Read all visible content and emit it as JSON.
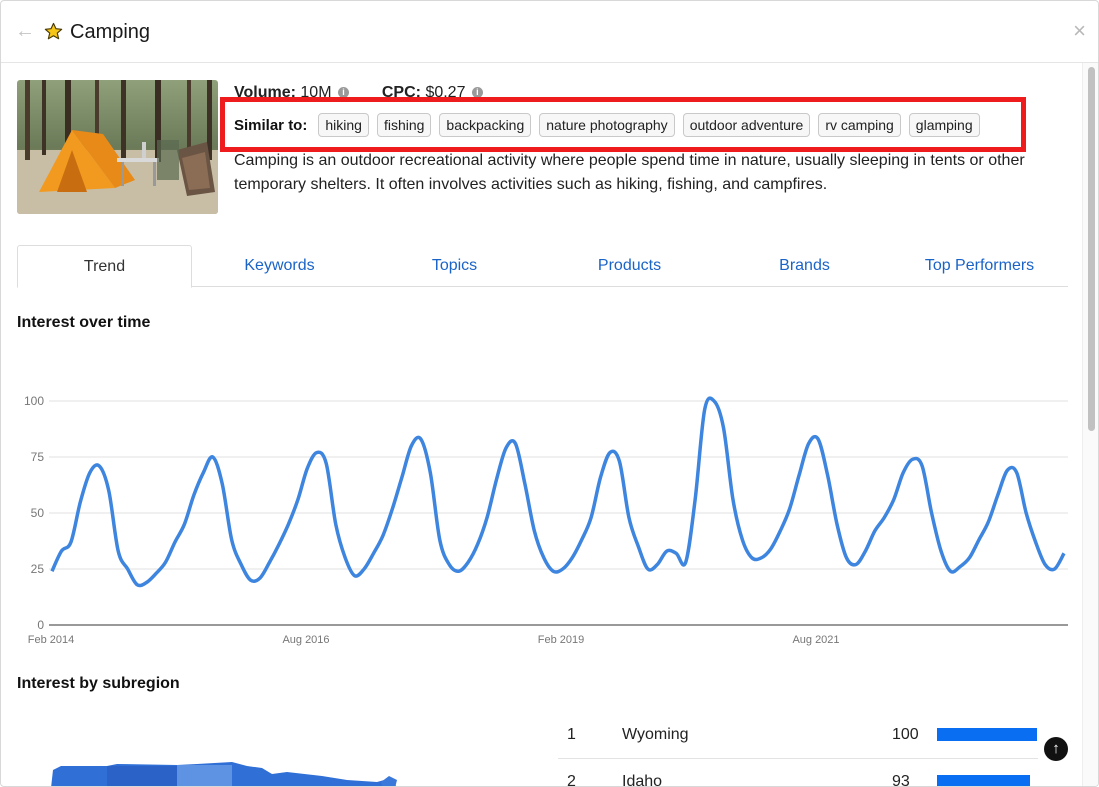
{
  "header": {
    "title": "Camping",
    "back_icon": "arrow-left-icon",
    "star_icon": "star-icon",
    "close_icon": "close-icon"
  },
  "meta": {
    "volume_label": "Volume:",
    "volume_value": "10M",
    "cpc_label": "CPC:",
    "cpc_value": "$0.27"
  },
  "similar": {
    "label": "Similar to:",
    "chips": [
      "hiking",
      "fishing",
      "backpacking",
      "nature photography",
      "outdoor adventure",
      "rv camping",
      "glamping"
    ]
  },
  "description": "Camping is an outdoor recreational activity where people spend time in nature, usually sleeping in tents or other temporary shelters. It often involves activities such as hiking, fishing, and campfires.",
  "tabs": [
    "Trend",
    "Keywords",
    "Topics",
    "Products",
    "Brands",
    "Top Performers"
  ],
  "active_tab": "Trend",
  "trend_section": {
    "title": "Interest over time"
  },
  "subregion_section": {
    "title": "Interest by subregion"
  },
  "subregions": [
    {
      "rank": "1",
      "name": "Wyoming",
      "value": "100"
    },
    {
      "rank": "2",
      "name": "Idaho",
      "value": "93"
    }
  ],
  "colors": {
    "accent": "#1a64c8",
    "line": "#3d85de",
    "bar": "#0a6ef3",
    "highlight": "#ee1c1c",
    "star": "#f5c518"
  },
  "chart_data": {
    "type": "line",
    "ylim": [
      0,
      100
    ],
    "y_ticks": [
      "0",
      "25",
      "50",
      "75",
      "100"
    ],
    "x_ticks": [
      "Feb 2014",
      "Aug 2016",
      "Feb 2019",
      "Aug 2021"
    ],
    "grid": true,
    "series": [
      {
        "values": [
          24,
          33,
          37,
          55,
          68,
          71,
          60,
          33,
          25,
          18,
          19,
          23,
          28,
          37,
          45,
          58,
          68,
          75,
          63,
          38,
          27,
          20,
          21,
          28,
          36,
          45,
          56,
          70,
          77,
          72,
          45,
          30,
          22,
          25,
          32,
          40,
          52,
          66,
          80,
          83,
          68,
          38,
          27,
          24,
          28,
          36,
          48,
          65,
          79,
          81,
          63,
          42,
          30,
          24,
          25,
          30,
          38,
          48,
          66,
          77,
          73,
          48,
          35,
          25,
          27,
          33,
          32,
          28,
          56,
          96,
          100,
          88,
          56,
          38,
          30,
          30,
          34,
          42,
          52,
          67,
          81,
          83,
          67,
          45,
          30,
          27,
          33,
          42,
          48,
          56,
          68,
          74,
          71,
          50,
          33,
          24,
          26,
          30,
          38,
          46,
          58,
          69,
          68,
          50,
          37,
          27,
          25,
          32
        ]
      }
    ]
  }
}
